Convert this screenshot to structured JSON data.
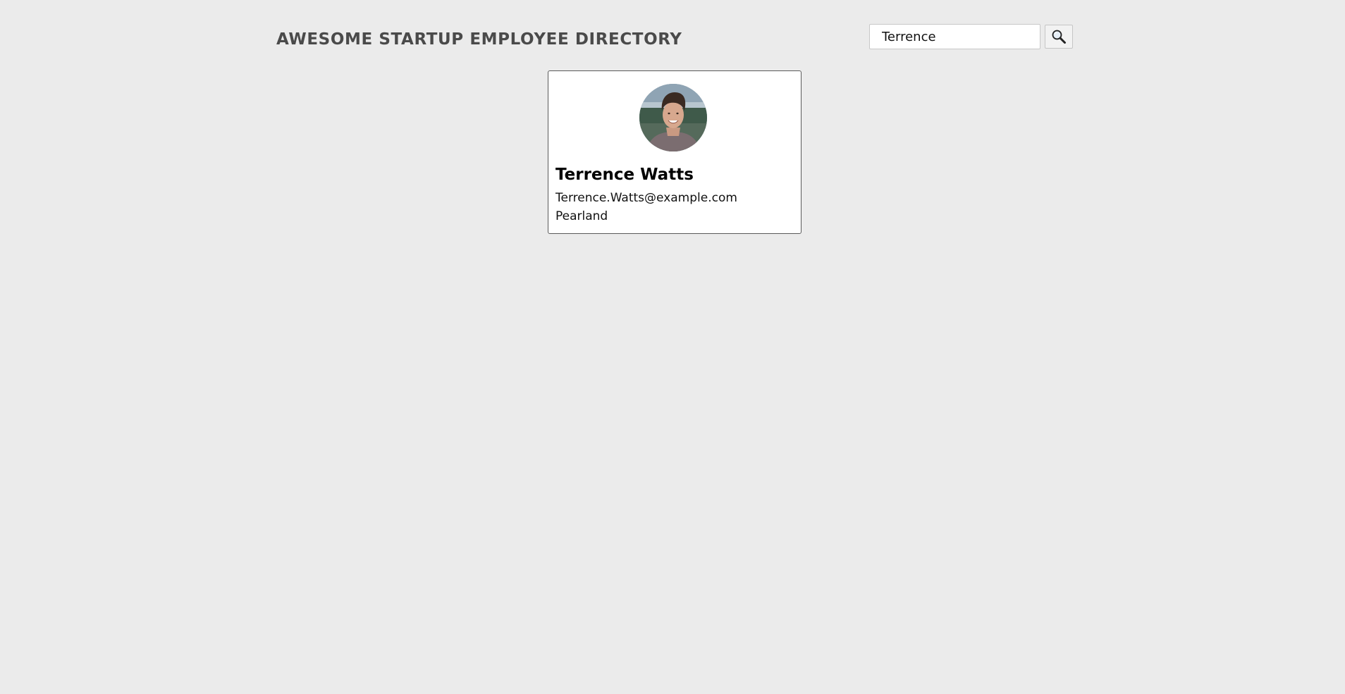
{
  "header": {
    "title": "AWESOME STARTUP EMPLOYEE DIRECTORY"
  },
  "search": {
    "value": "Terrence",
    "button_icon": "search-icon"
  },
  "employees": [
    {
      "name": "Terrence Watts",
      "email": "Terrence.Watts@example.com",
      "city": "Pearland",
      "avatar_icon": "avatar-photo"
    }
  ],
  "colors": {
    "background": "#ebebeb",
    "title": "#4a4a4a",
    "card_background": "#ffffff",
    "card_border": "#5a5a5a"
  }
}
